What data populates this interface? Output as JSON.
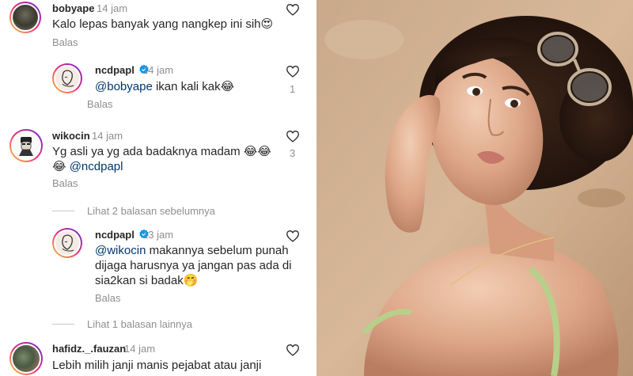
{
  "comments": [
    {
      "username": "bobyape",
      "time": "14 jam",
      "text": "Kalo lepas banyak yang nangkep ini sih😍",
      "reply_label": "Balas",
      "likes": ""
    },
    {
      "username": "ncdpapl",
      "time": "14 jam",
      "mention": "@bobyape",
      "text": " ikan kali kak😂",
      "reply_label": "Balas",
      "likes": "1"
    },
    {
      "username": "wikocin",
      "time": "14 jam",
      "text_line1": "Yg asli ya yg ada badaknya madam 😂😂",
      "text_line2_emoji": "😂 ",
      "mention": "@ncdpapl",
      "reply_label": "Balas",
      "likes": "3"
    },
    {
      "username": "ncdpapl",
      "time": "13 jam",
      "mention": "@wikocin",
      "text_line1": " makannya sebelum punah",
      "text_line2": "dijaga harusnya ya jangan pas ada di",
      "text_line3": "sia2kan si badak🤭",
      "reply_label": "Balas"
    },
    {
      "username": "hafidz._.fauzan",
      "time": "14 jam",
      "text_line1": "Lebih milih janji manis pejabat atau janji"
    }
  ],
  "view_more": [
    {
      "label": "Lihat 2 balasan sebelumnya"
    },
    {
      "label": "Lihat 1 balasan lainnya"
    }
  ],
  "icons": {
    "like": "heart-outline-icon",
    "verified": "verified-badge-icon"
  },
  "colors": {
    "mention": "#00376b",
    "secondary_text": "#8e8e8e",
    "verified": "#0095f6"
  }
}
